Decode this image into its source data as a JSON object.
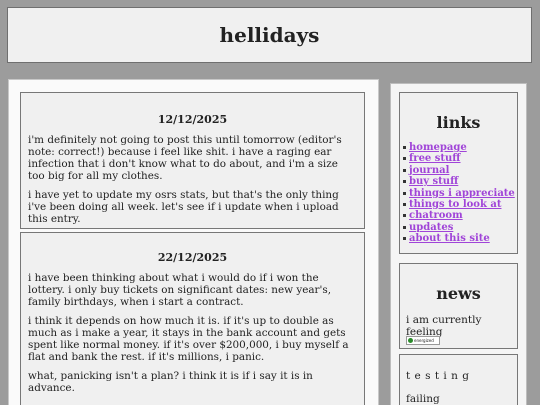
{
  "site": {
    "title": "hellidays"
  },
  "posts": [
    {
      "date": "12/12/2025",
      "paragraphs": [
        "i'm definitely not going to post this until tomorrow (editor's note: correct!) because i feel like shit. i have a raging ear infection that i don't know what to do about, and i'm a size too big for all my clothes.",
        "i have yet to update my osrs stats, but that's the only thing i've been doing all week. let's see if i update when i upload this entry."
      ]
    },
    {
      "date": "22/12/2025",
      "paragraphs": [
        "i have been thinking about what i would do if i won the lottery. i only buy tickets on significant dates: new year's, family birthdays, when i start a contract.",
        "i think it depends on how much it is. if it's up to double as much as i make a year, it stays in the bank account and gets spent like normal money. if it's over $200,000, i buy myself a flat and bank the rest. if it's millions, i panic.",
        "what, panicking isn't a plan? i think it is if i say it is in advance."
      ]
    }
  ],
  "sidebar": {
    "links_title": "links",
    "links": [
      "homepage",
      "free stuff",
      "journal",
      "buy stuff",
      "things i appreciate",
      "things to look at",
      "chatroom",
      "updates",
      "about this site"
    ],
    "news_title": "news",
    "news_text": "i am currently feeling",
    "mood_label": "energized",
    "testing_title": "t e s t i n g",
    "testing_text": "failing"
  },
  "colors": {
    "link": "#a044d8",
    "background": "#9c9c9c",
    "panel": "#f0f0f0"
  }
}
